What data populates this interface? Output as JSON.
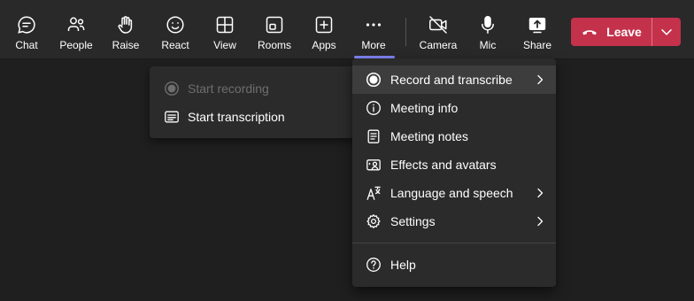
{
  "toolbar": {
    "chat": "Chat",
    "people": "People",
    "raise": "Raise",
    "react": "React",
    "view": "View",
    "rooms": "Rooms",
    "apps": "Apps",
    "more": "More",
    "camera": "Camera",
    "mic": "Mic",
    "share": "Share",
    "leave": "Leave"
  },
  "more_menu": {
    "items": [
      {
        "label": "Record and transcribe",
        "icon": "record-icon",
        "submenu": true
      },
      {
        "label": "Meeting info",
        "icon": "info-icon",
        "submenu": false
      },
      {
        "label": "Meeting notes",
        "icon": "notes-icon",
        "submenu": false
      },
      {
        "label": "Effects and avatars",
        "icon": "effects-icon",
        "submenu": false
      },
      {
        "label": "Language and speech",
        "icon": "language-icon",
        "submenu": true
      },
      {
        "label": "Settings",
        "icon": "gear-icon",
        "submenu": true
      },
      {
        "label": "Help",
        "icon": "help-icon",
        "submenu": false
      }
    ]
  },
  "record_submenu": {
    "items": [
      {
        "label": "Start recording",
        "icon": "record-icon",
        "disabled": true
      },
      {
        "label": "Start transcription",
        "icon": "transcript-icon",
        "disabled": false
      }
    ]
  },
  "colors": {
    "accent": "#7f85f5",
    "leave": "#c4314b",
    "background": "#1f1f1f",
    "toolbar": "#292929",
    "menu": "#2b2b2b"
  }
}
